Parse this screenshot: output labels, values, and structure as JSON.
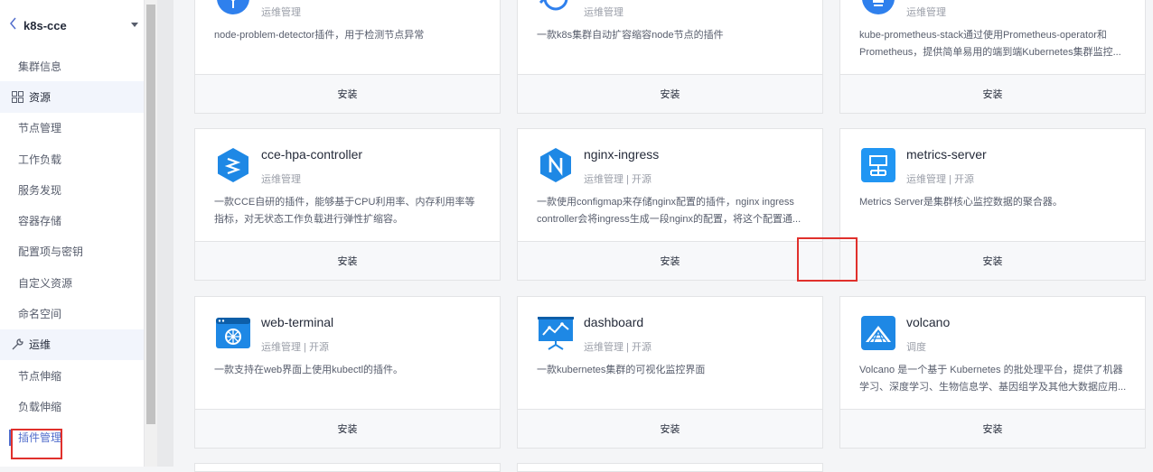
{
  "cluster": {
    "back_icon": "chevron-left-icon",
    "name": "k8s-cce",
    "dropdown_icon": "caret-down-icon"
  },
  "sidebar": {
    "items": [
      {
        "type": "item",
        "label": "集群信息"
      },
      {
        "type": "group",
        "label": "资源",
        "icon": "grid-icon"
      },
      {
        "type": "item",
        "label": "节点管理"
      },
      {
        "type": "item",
        "label": "工作负载"
      },
      {
        "type": "item",
        "label": "服务发现"
      },
      {
        "type": "item",
        "label": "容器存储"
      },
      {
        "type": "item",
        "label": "配置项与密钥"
      },
      {
        "type": "item",
        "label": "自定义资源"
      },
      {
        "type": "item",
        "label": "命名空间"
      },
      {
        "type": "group",
        "label": "运维",
        "icon": "wrench-icon"
      },
      {
        "type": "item",
        "label": "节点伸缩"
      },
      {
        "type": "item",
        "label": "负载伸缩"
      },
      {
        "type": "item",
        "label": "插件管理",
        "active": true
      }
    ]
  },
  "addons": [
    {
      "title": "",
      "tags": "运维管理",
      "desc": "node-problem-detector插件，用于检测节点异常",
      "install": "安装",
      "icon": "network-node-icon",
      "color": "#2f80ed"
    },
    {
      "title": "",
      "tags": "运维管理",
      "desc": "一款k8s集群自动扩容缩容node节点的插件",
      "install": "安装",
      "icon": "autoscaler-icon",
      "color": "#2f80ed"
    },
    {
      "title": "",
      "tags": "运维管理",
      "desc": "kube-prometheus-stack通过使用Prometheus-operator和Prometheus，提供简单易用的端到端Kubernetes集群监控...",
      "install": "安装",
      "icon": "prometheus-icon",
      "color": "#2f80ed"
    },
    {
      "title": "cce-hpa-controller",
      "tags": "运维管理",
      "desc": "一款CCE自研的插件，能够基于CPU利用率、内存利用率等指标，对无状态工作负载进行弹性扩缩容。",
      "install": "安装",
      "icon": "hpa-icon",
      "color": "#1e88e5"
    },
    {
      "title": "nginx-ingress",
      "tags": "运维管理 | 开源",
      "desc": "一款使用configmap来存储nginx配置的插件，nginx ingress controller会将ingress生成一段nginx的配置，将这个配置通...",
      "install": "安装",
      "icon": "nginx-icon",
      "color": "#1e88e5"
    },
    {
      "title": "metrics-server",
      "tags": "运维管理 | 开源",
      "desc": "Metrics Server是集群核心监控数据的聚合器。",
      "install": "安装",
      "icon": "metrics-icon",
      "color": "#2196f3"
    },
    {
      "title": "web-terminal",
      "tags": "运维管理 | 开源",
      "desc": "一款支持在web界面上使用kubectl的插件。",
      "install": "安装",
      "icon": "terminal-icon",
      "color": "#1e88e5"
    },
    {
      "title": "dashboard",
      "tags": "运维管理 | 开源",
      "desc": "一款kubernetes集群的可视化监控界面",
      "install": "安装",
      "icon": "dashboard-icon",
      "color": "#1e88e5"
    },
    {
      "title": "volcano",
      "tags": "调度",
      "desc": "Volcano 是一个基于 Kubernetes 的批处理平台，提供了机器学习、深度学习、生物信息学、基因组学及其他大数据应用...",
      "install": "安装",
      "icon": "volcano-icon",
      "color": "#1e88e5"
    }
  ]
}
